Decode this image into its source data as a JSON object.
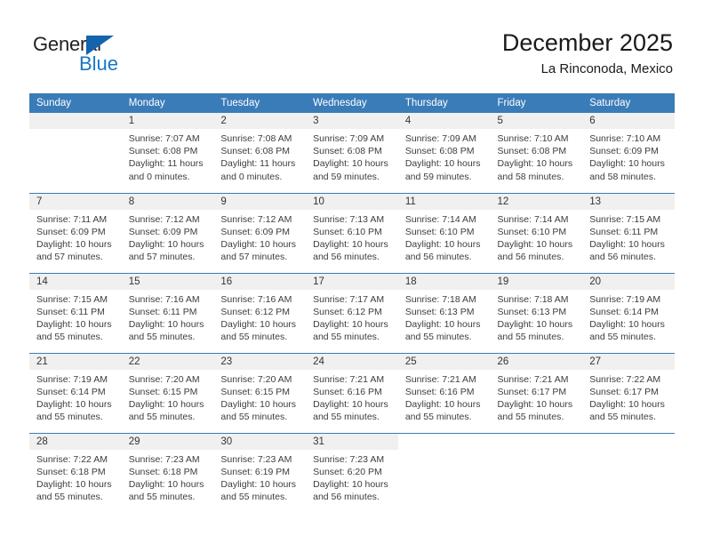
{
  "logo": {
    "word_one": "General",
    "word_two": "Blue",
    "triangle_icon": "blue-triangle-icon",
    "accent_color": "#1463ad",
    "blue_text_color": "#1877c4"
  },
  "header": {
    "title": "December 2025",
    "location": "La Rinconoda, Mexico"
  },
  "theme": {
    "header_bg": "#3a7cb8",
    "daynum_bg": "#f0f0f0",
    "text_color": "#3d3d3d"
  },
  "weekdays": [
    "Sunday",
    "Monday",
    "Tuesday",
    "Wednesday",
    "Thursday",
    "Friday",
    "Saturday"
  ],
  "weeks": [
    [
      {
        "day": "",
        "sunrise": "",
        "sunset": "",
        "daylight": "",
        "daylight2": "",
        "state": "empty"
      },
      {
        "day": "1",
        "sunrise": "Sunrise: 7:07 AM",
        "sunset": "Sunset: 6:08 PM",
        "daylight": "Daylight: 11 hours",
        "daylight2": "and 0 minutes.",
        "state": "filled"
      },
      {
        "day": "2",
        "sunrise": "Sunrise: 7:08 AM",
        "sunset": "Sunset: 6:08 PM",
        "daylight": "Daylight: 11 hours",
        "daylight2": "and 0 minutes.",
        "state": "filled"
      },
      {
        "day": "3",
        "sunrise": "Sunrise: 7:09 AM",
        "sunset": "Sunset: 6:08 PM",
        "daylight": "Daylight: 10 hours",
        "daylight2": "and 59 minutes.",
        "state": "filled"
      },
      {
        "day": "4",
        "sunrise": "Sunrise: 7:09 AM",
        "sunset": "Sunset: 6:08 PM",
        "daylight": "Daylight: 10 hours",
        "daylight2": "and 59 minutes.",
        "state": "filled"
      },
      {
        "day": "5",
        "sunrise": "Sunrise: 7:10 AM",
        "sunset": "Sunset: 6:08 PM",
        "daylight": "Daylight: 10 hours",
        "daylight2": "and 58 minutes.",
        "state": "filled"
      },
      {
        "day": "6",
        "sunrise": "Sunrise: 7:10 AM",
        "sunset": "Sunset: 6:09 PM",
        "daylight": "Daylight: 10 hours",
        "daylight2": "and 58 minutes.",
        "state": "filled"
      }
    ],
    [
      {
        "day": "7",
        "sunrise": "Sunrise: 7:11 AM",
        "sunset": "Sunset: 6:09 PM",
        "daylight": "Daylight: 10 hours",
        "daylight2": "and 57 minutes.",
        "state": "filled"
      },
      {
        "day": "8",
        "sunrise": "Sunrise: 7:12 AM",
        "sunset": "Sunset: 6:09 PM",
        "daylight": "Daylight: 10 hours",
        "daylight2": "and 57 minutes.",
        "state": "filled"
      },
      {
        "day": "9",
        "sunrise": "Sunrise: 7:12 AM",
        "sunset": "Sunset: 6:09 PM",
        "daylight": "Daylight: 10 hours",
        "daylight2": "and 57 minutes.",
        "state": "filled"
      },
      {
        "day": "10",
        "sunrise": "Sunrise: 7:13 AM",
        "sunset": "Sunset: 6:10 PM",
        "daylight": "Daylight: 10 hours",
        "daylight2": "and 56 minutes.",
        "state": "filled"
      },
      {
        "day": "11",
        "sunrise": "Sunrise: 7:14 AM",
        "sunset": "Sunset: 6:10 PM",
        "daylight": "Daylight: 10 hours",
        "daylight2": "and 56 minutes.",
        "state": "filled"
      },
      {
        "day": "12",
        "sunrise": "Sunrise: 7:14 AM",
        "sunset": "Sunset: 6:10 PM",
        "daylight": "Daylight: 10 hours",
        "daylight2": "and 56 minutes.",
        "state": "filled"
      },
      {
        "day": "13",
        "sunrise": "Sunrise: 7:15 AM",
        "sunset": "Sunset: 6:11 PM",
        "daylight": "Daylight: 10 hours",
        "daylight2": "and 56 minutes.",
        "state": "filled"
      }
    ],
    [
      {
        "day": "14",
        "sunrise": "Sunrise: 7:15 AM",
        "sunset": "Sunset: 6:11 PM",
        "daylight": "Daylight: 10 hours",
        "daylight2": "and 55 minutes.",
        "state": "filled"
      },
      {
        "day": "15",
        "sunrise": "Sunrise: 7:16 AM",
        "sunset": "Sunset: 6:11 PM",
        "daylight": "Daylight: 10 hours",
        "daylight2": "and 55 minutes.",
        "state": "filled"
      },
      {
        "day": "16",
        "sunrise": "Sunrise: 7:16 AM",
        "sunset": "Sunset: 6:12 PM",
        "daylight": "Daylight: 10 hours",
        "daylight2": "and 55 minutes.",
        "state": "filled"
      },
      {
        "day": "17",
        "sunrise": "Sunrise: 7:17 AM",
        "sunset": "Sunset: 6:12 PM",
        "daylight": "Daylight: 10 hours",
        "daylight2": "and 55 minutes.",
        "state": "filled"
      },
      {
        "day": "18",
        "sunrise": "Sunrise: 7:18 AM",
        "sunset": "Sunset: 6:13 PM",
        "daylight": "Daylight: 10 hours",
        "daylight2": "and 55 minutes.",
        "state": "filled"
      },
      {
        "day": "19",
        "sunrise": "Sunrise: 7:18 AM",
        "sunset": "Sunset: 6:13 PM",
        "daylight": "Daylight: 10 hours",
        "daylight2": "and 55 minutes.",
        "state": "filled"
      },
      {
        "day": "20",
        "sunrise": "Sunrise: 7:19 AM",
        "sunset": "Sunset: 6:14 PM",
        "daylight": "Daylight: 10 hours",
        "daylight2": "and 55 minutes.",
        "state": "filled"
      }
    ],
    [
      {
        "day": "21",
        "sunrise": "Sunrise: 7:19 AM",
        "sunset": "Sunset: 6:14 PM",
        "daylight": "Daylight: 10 hours",
        "daylight2": "and 55 minutes.",
        "state": "filled"
      },
      {
        "day": "22",
        "sunrise": "Sunrise: 7:20 AM",
        "sunset": "Sunset: 6:15 PM",
        "daylight": "Daylight: 10 hours",
        "daylight2": "and 55 minutes.",
        "state": "filled"
      },
      {
        "day": "23",
        "sunrise": "Sunrise: 7:20 AM",
        "sunset": "Sunset: 6:15 PM",
        "daylight": "Daylight: 10 hours",
        "daylight2": "and 55 minutes.",
        "state": "filled"
      },
      {
        "day": "24",
        "sunrise": "Sunrise: 7:21 AM",
        "sunset": "Sunset: 6:16 PM",
        "daylight": "Daylight: 10 hours",
        "daylight2": "and 55 minutes.",
        "state": "filled"
      },
      {
        "day": "25",
        "sunrise": "Sunrise: 7:21 AM",
        "sunset": "Sunset: 6:16 PM",
        "daylight": "Daylight: 10 hours",
        "daylight2": "and 55 minutes.",
        "state": "filled"
      },
      {
        "day": "26",
        "sunrise": "Sunrise: 7:21 AM",
        "sunset": "Sunset: 6:17 PM",
        "daylight": "Daylight: 10 hours",
        "daylight2": "and 55 minutes.",
        "state": "filled"
      },
      {
        "day": "27",
        "sunrise": "Sunrise: 7:22 AM",
        "sunset": "Sunset: 6:17 PM",
        "daylight": "Daylight: 10 hours",
        "daylight2": "and 55 minutes.",
        "state": "filled"
      }
    ],
    [
      {
        "day": "28",
        "sunrise": "Sunrise: 7:22 AM",
        "sunset": "Sunset: 6:18 PM",
        "daylight": "Daylight: 10 hours",
        "daylight2": "and 55 minutes.",
        "state": "filled"
      },
      {
        "day": "29",
        "sunrise": "Sunrise: 7:23 AM",
        "sunset": "Sunset: 6:18 PM",
        "daylight": "Daylight: 10 hours",
        "daylight2": "and 55 minutes.",
        "state": "filled"
      },
      {
        "day": "30",
        "sunrise": "Sunrise: 7:23 AM",
        "sunset": "Sunset: 6:19 PM",
        "daylight": "Daylight: 10 hours",
        "daylight2": "and 55 minutes.",
        "state": "filled"
      },
      {
        "day": "31",
        "sunrise": "Sunrise: 7:23 AM",
        "sunset": "Sunset: 6:20 PM",
        "daylight": "Daylight: 10 hours",
        "daylight2": "and 56 minutes.",
        "state": "filled"
      },
      {
        "day": "",
        "sunrise": "",
        "sunset": "",
        "daylight": "",
        "daylight2": "",
        "state": "blank"
      },
      {
        "day": "",
        "sunrise": "",
        "sunset": "",
        "daylight": "",
        "daylight2": "",
        "state": "blank"
      },
      {
        "day": "",
        "sunrise": "",
        "sunset": "",
        "daylight": "",
        "daylight2": "",
        "state": "blank"
      }
    ]
  ]
}
